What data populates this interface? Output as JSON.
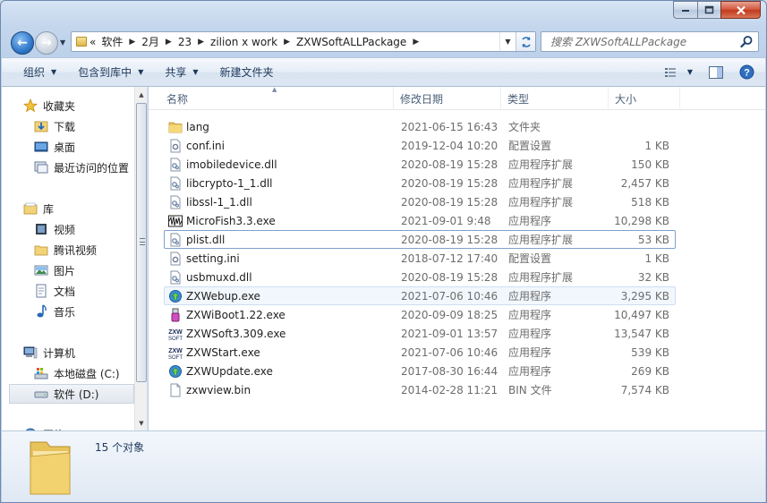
{
  "address": {
    "overflow": "«",
    "segments": [
      "软件",
      "2月",
      "23",
      "zilion x work",
      "ZXWSoftALLPackage"
    ]
  },
  "search": {
    "placeholder": "搜索 ZXWSoftALLPackage"
  },
  "toolbar": {
    "organize": "组织",
    "include_in_library": "包含到库中",
    "share": "共享",
    "new_folder": "新建文件夹"
  },
  "nav": {
    "favorites": "收藏夹",
    "downloads": "下载",
    "desktop": "桌面",
    "recent": "最近访问的位置",
    "libraries": "库",
    "videos": "视频",
    "tencent_video": "腾讯视频",
    "pictures": "图片",
    "documents": "文档",
    "music": "音乐",
    "computer": "计算机",
    "local_disk_c": "本地磁盘 (C:)",
    "software_d": "软件 (D:)",
    "network": "网络"
  },
  "columns": {
    "name": "名称",
    "date": "修改日期",
    "type": "类型",
    "size": "大小"
  },
  "files": [
    {
      "name": "lang",
      "date": "2021-06-15 16:43",
      "type": "文件夹",
      "size": "",
      "icon": "folder-icon"
    },
    {
      "name": "conf.ini",
      "date": "2019-12-04 10:20",
      "type": "配置设置",
      "size": "1 KB",
      "icon": "settings-file-icon"
    },
    {
      "name": "imobiledevice.dll",
      "date": "2020-08-19 15:28",
      "type": "应用程序扩展",
      "size": "150 KB",
      "icon": "dll-file-icon"
    },
    {
      "name": "libcrypto-1_1.dll",
      "date": "2020-08-19 15:28",
      "type": "应用程序扩展",
      "size": "2,457 KB",
      "icon": "dll-file-icon"
    },
    {
      "name": "libssl-1_1.dll",
      "date": "2020-08-19 15:28",
      "type": "应用程序扩展",
      "size": "518 KB",
      "icon": "dll-file-icon"
    },
    {
      "name": "MicroFish3.3.exe",
      "date": "2021-09-01 9:48",
      "type": "应用程序",
      "size": "10,298 KB",
      "icon": "waveform-app-icon"
    },
    {
      "name": "plist.dll",
      "date": "2020-08-19 15:28",
      "type": "应用程序扩展",
      "size": "53 KB",
      "icon": "dll-file-icon"
    },
    {
      "name": "setting.ini",
      "date": "2018-07-12 17:40",
      "type": "配置设置",
      "size": "1 KB",
      "icon": "settings-file-icon"
    },
    {
      "name": "usbmuxd.dll",
      "date": "2020-08-19 15:28",
      "type": "应用程序扩展",
      "size": "32 KB",
      "icon": "dll-file-icon"
    },
    {
      "name": "ZXWebup.exe",
      "date": "2021-07-06 10:46",
      "type": "应用程序",
      "size": "3,295 KB",
      "icon": "update-app-icon"
    },
    {
      "name": "ZXWiBoot1.22.exe",
      "date": "2020-09-09 18:25",
      "type": "应用程序",
      "size": "10,497 KB",
      "icon": "usb-app-icon"
    },
    {
      "name": "ZXWSoft3.309.exe",
      "date": "2021-09-01 13:57",
      "type": "应用程序",
      "size": "13,547 KB",
      "icon": "zxw-logo-icon"
    },
    {
      "name": "ZXWStart.exe",
      "date": "2021-07-06 10:46",
      "type": "应用程序",
      "size": "539 KB",
      "icon": "zxw-logo-icon"
    },
    {
      "name": "ZXWUpdate.exe",
      "date": "2017-08-30 16:44",
      "type": "应用程序",
      "size": "269 KB",
      "icon": "update-app-icon"
    },
    {
      "name": "zxwview.bin",
      "date": "2014-02-28 11:21",
      "type": "BIN 文件",
      "size": "7,574 KB",
      "icon": "blank-file-icon"
    }
  ],
  "status": {
    "count_text": "15 个对象"
  }
}
